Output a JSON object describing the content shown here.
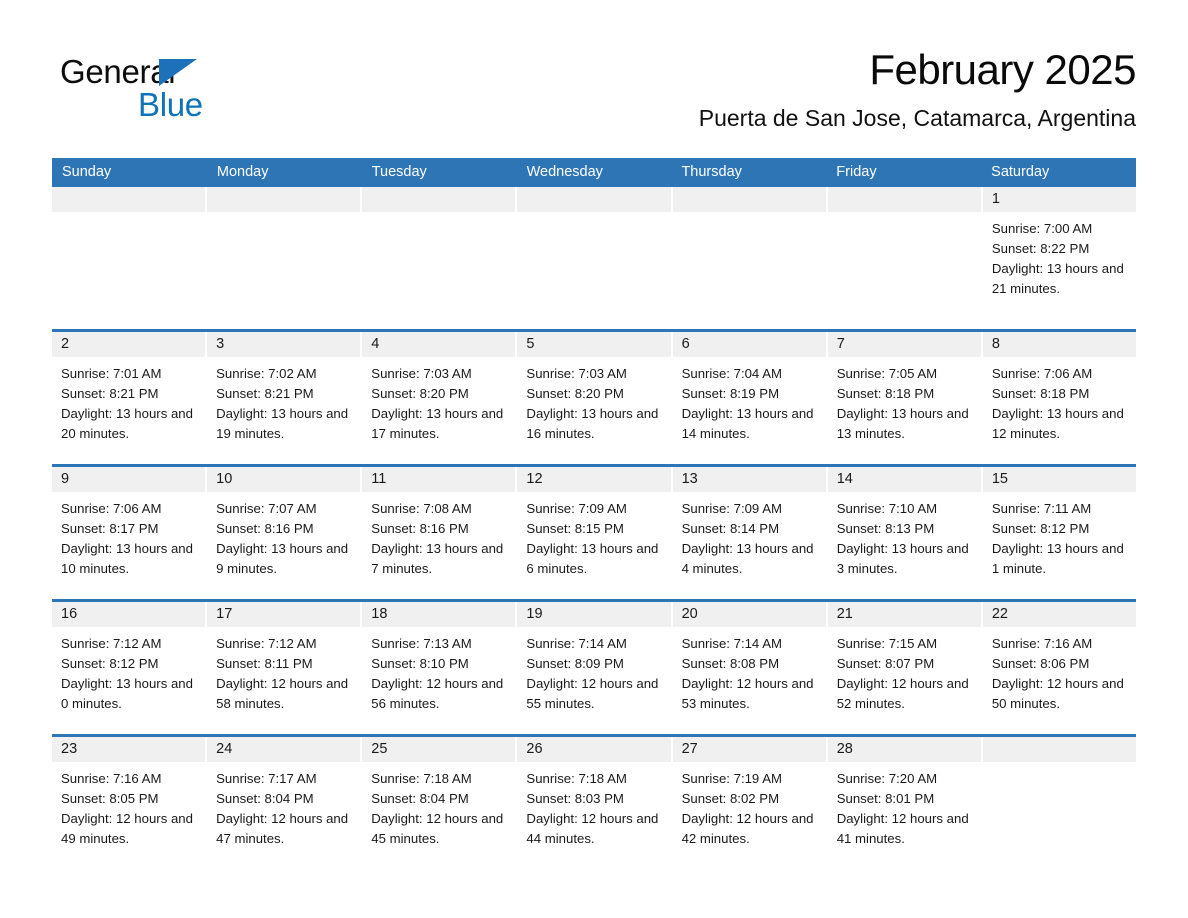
{
  "brand": {
    "name_part1": "General",
    "name_part2": "Blue",
    "triangle_icon": "triangle-icon",
    "color_blue": "#1072b9",
    "color_black": "#0d0d0d"
  },
  "header": {
    "title": "February 2025",
    "location": "Puerta de San Jose, Catamarca, Argentina"
  },
  "theme": {
    "header_row_blue": "#2e75b6",
    "row_rule_blue": "#2e75b6",
    "day_band_gray": "#f0f0f0",
    "text_dark": "#1a1a1a"
  },
  "weekdays": [
    "Sunday",
    "Monday",
    "Tuesday",
    "Wednesday",
    "Thursday",
    "Friday",
    "Saturday"
  ],
  "weeks": [
    [
      {
        "day": "",
        "sunrise": "",
        "sunset": "",
        "daylight": "",
        "empty": true
      },
      {
        "day": "",
        "sunrise": "",
        "sunset": "",
        "daylight": "",
        "empty": true
      },
      {
        "day": "",
        "sunrise": "",
        "sunset": "",
        "daylight": "",
        "empty": true
      },
      {
        "day": "",
        "sunrise": "",
        "sunset": "",
        "daylight": "",
        "empty": true
      },
      {
        "day": "",
        "sunrise": "",
        "sunset": "",
        "daylight": "",
        "empty": true
      },
      {
        "day": "",
        "sunrise": "",
        "sunset": "",
        "daylight": "",
        "empty": true
      },
      {
        "day": "1",
        "sunrise": "Sunrise: 7:00 AM",
        "sunset": "Sunset: 8:22 PM",
        "daylight": "Daylight: 13 hours and 21 minutes.",
        "empty": false
      }
    ],
    [
      {
        "day": "2",
        "sunrise": "Sunrise: 7:01 AM",
        "sunset": "Sunset: 8:21 PM",
        "daylight": "Daylight: 13 hours and 20 minutes.",
        "empty": false
      },
      {
        "day": "3",
        "sunrise": "Sunrise: 7:02 AM",
        "sunset": "Sunset: 8:21 PM",
        "daylight": "Daylight: 13 hours and 19 minutes.",
        "empty": false
      },
      {
        "day": "4",
        "sunrise": "Sunrise: 7:03 AM",
        "sunset": "Sunset: 8:20 PM",
        "daylight": "Daylight: 13 hours and 17 minutes.",
        "empty": false
      },
      {
        "day": "5",
        "sunrise": "Sunrise: 7:03 AM",
        "sunset": "Sunset: 8:20 PM",
        "daylight": "Daylight: 13 hours and 16 minutes.",
        "empty": false
      },
      {
        "day": "6",
        "sunrise": "Sunrise: 7:04 AM",
        "sunset": "Sunset: 8:19 PM",
        "daylight": "Daylight: 13 hours and 14 minutes.",
        "empty": false
      },
      {
        "day": "7",
        "sunrise": "Sunrise: 7:05 AM",
        "sunset": "Sunset: 8:18 PM",
        "daylight": "Daylight: 13 hours and 13 minutes.",
        "empty": false
      },
      {
        "day": "8",
        "sunrise": "Sunrise: 7:06 AM",
        "sunset": "Sunset: 8:18 PM",
        "daylight": "Daylight: 13 hours and 12 minutes.",
        "empty": false
      }
    ],
    [
      {
        "day": "9",
        "sunrise": "Sunrise: 7:06 AM",
        "sunset": "Sunset: 8:17 PM",
        "daylight": "Daylight: 13 hours and 10 minutes.",
        "empty": false
      },
      {
        "day": "10",
        "sunrise": "Sunrise: 7:07 AM",
        "sunset": "Sunset: 8:16 PM",
        "daylight": "Daylight: 13 hours and 9 minutes.",
        "empty": false
      },
      {
        "day": "11",
        "sunrise": "Sunrise: 7:08 AM",
        "sunset": "Sunset: 8:16 PM",
        "daylight": "Daylight: 13 hours and 7 minutes.",
        "empty": false
      },
      {
        "day": "12",
        "sunrise": "Sunrise: 7:09 AM",
        "sunset": "Sunset: 8:15 PM",
        "daylight": "Daylight: 13 hours and 6 minutes.",
        "empty": false
      },
      {
        "day": "13",
        "sunrise": "Sunrise: 7:09 AM",
        "sunset": "Sunset: 8:14 PM",
        "daylight": "Daylight: 13 hours and 4 minutes.",
        "empty": false
      },
      {
        "day": "14",
        "sunrise": "Sunrise: 7:10 AM",
        "sunset": "Sunset: 8:13 PM",
        "daylight": "Daylight: 13 hours and 3 minutes.",
        "empty": false
      },
      {
        "day": "15",
        "sunrise": "Sunrise: 7:11 AM",
        "sunset": "Sunset: 8:12 PM",
        "daylight": "Daylight: 13 hours and 1 minute.",
        "empty": false
      }
    ],
    [
      {
        "day": "16",
        "sunrise": "Sunrise: 7:12 AM",
        "sunset": "Sunset: 8:12 PM",
        "daylight": "Daylight: 13 hours and 0 minutes.",
        "empty": false
      },
      {
        "day": "17",
        "sunrise": "Sunrise: 7:12 AM",
        "sunset": "Sunset: 8:11 PM",
        "daylight": "Daylight: 12 hours and 58 minutes.",
        "empty": false
      },
      {
        "day": "18",
        "sunrise": "Sunrise: 7:13 AM",
        "sunset": "Sunset: 8:10 PM",
        "daylight": "Daylight: 12 hours and 56 minutes.",
        "empty": false
      },
      {
        "day": "19",
        "sunrise": "Sunrise: 7:14 AM",
        "sunset": "Sunset: 8:09 PM",
        "daylight": "Daylight: 12 hours and 55 minutes.",
        "empty": false
      },
      {
        "day": "20",
        "sunrise": "Sunrise: 7:14 AM",
        "sunset": "Sunset: 8:08 PM",
        "daylight": "Daylight: 12 hours and 53 minutes.",
        "empty": false
      },
      {
        "day": "21",
        "sunrise": "Sunrise: 7:15 AM",
        "sunset": "Sunset: 8:07 PM",
        "daylight": "Daylight: 12 hours and 52 minutes.",
        "empty": false
      },
      {
        "day": "22",
        "sunrise": "Sunrise: 7:16 AM",
        "sunset": "Sunset: 8:06 PM",
        "daylight": "Daylight: 12 hours and 50 minutes.",
        "empty": false
      }
    ],
    [
      {
        "day": "23",
        "sunrise": "Sunrise: 7:16 AM",
        "sunset": "Sunset: 8:05 PM",
        "daylight": "Daylight: 12 hours and 49 minutes.",
        "empty": false
      },
      {
        "day": "24",
        "sunrise": "Sunrise: 7:17 AM",
        "sunset": "Sunset: 8:04 PM",
        "daylight": "Daylight: 12 hours and 47 minutes.",
        "empty": false
      },
      {
        "day": "25",
        "sunrise": "Sunrise: 7:18 AM",
        "sunset": "Sunset: 8:04 PM",
        "daylight": "Daylight: 12 hours and 45 minutes.",
        "empty": false
      },
      {
        "day": "26",
        "sunrise": "Sunrise: 7:18 AM",
        "sunset": "Sunset: 8:03 PM",
        "daylight": "Daylight: 12 hours and 44 minutes.",
        "empty": false
      },
      {
        "day": "27",
        "sunrise": "Sunrise: 7:19 AM",
        "sunset": "Sunset: 8:02 PM",
        "daylight": "Daylight: 12 hours and 42 minutes.",
        "empty": false
      },
      {
        "day": "28",
        "sunrise": "Sunrise: 7:20 AM",
        "sunset": "Sunset: 8:01 PM",
        "daylight": "Daylight: 12 hours and 41 minutes.",
        "empty": false
      },
      {
        "day": "",
        "sunrise": "",
        "sunset": "",
        "daylight": "",
        "empty": true
      }
    ]
  ]
}
